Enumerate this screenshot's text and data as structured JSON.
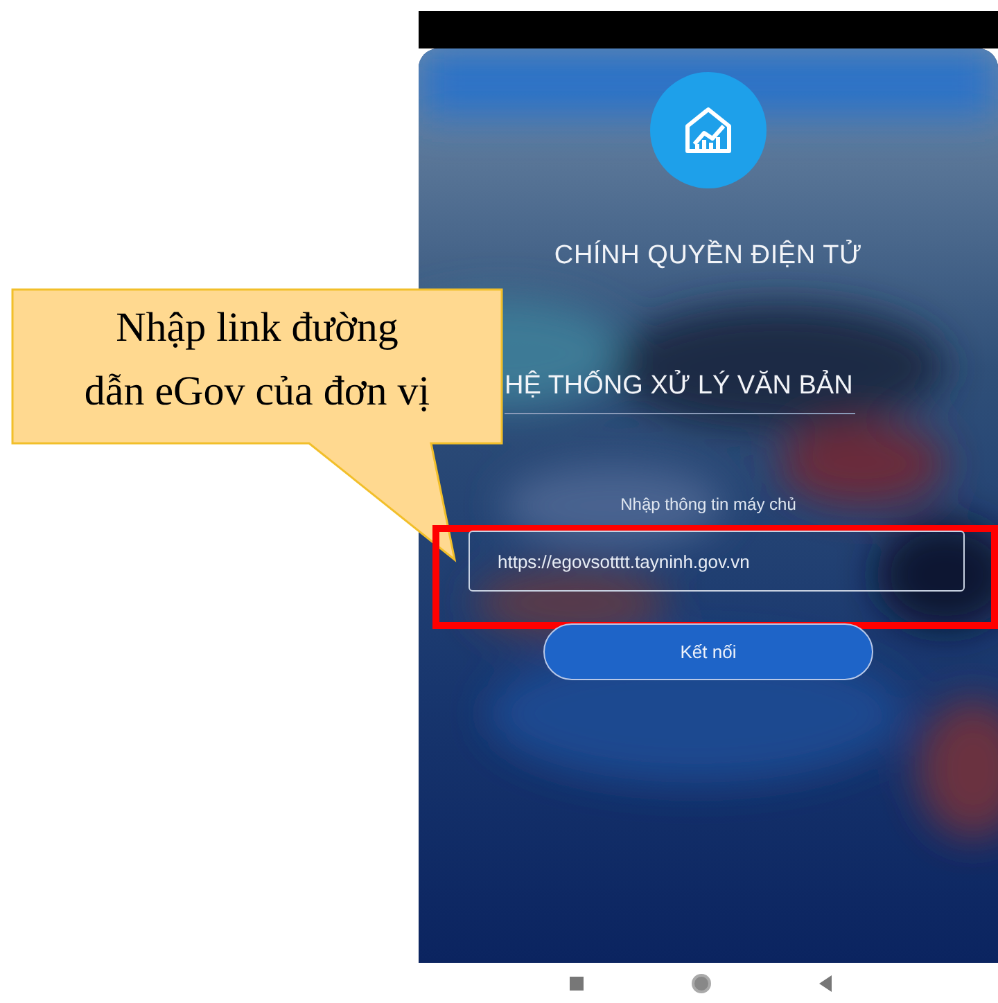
{
  "app": {
    "title": "CHÍNH QUYỀN ĐIỆN TỬ",
    "subtitle": "HỆ THỐNG XỬ LÝ VĂN BẢN",
    "server_label": "Nhập thông tin máy chủ",
    "server_field": {
      "value": "https://egovsotttt.tayninh.gov.vn"
    },
    "connect_button": "Kết nối"
  },
  "navigation_bar": {
    "buttons": [
      {
        "kind": "recents"
      },
      {
        "kind": "home"
      },
      {
        "kind": "back"
      }
    ]
  },
  "annotation": {
    "lines": [
      "Nhập link đường",
      "dẫn eGov của đơn vị"
    ]
  }
}
